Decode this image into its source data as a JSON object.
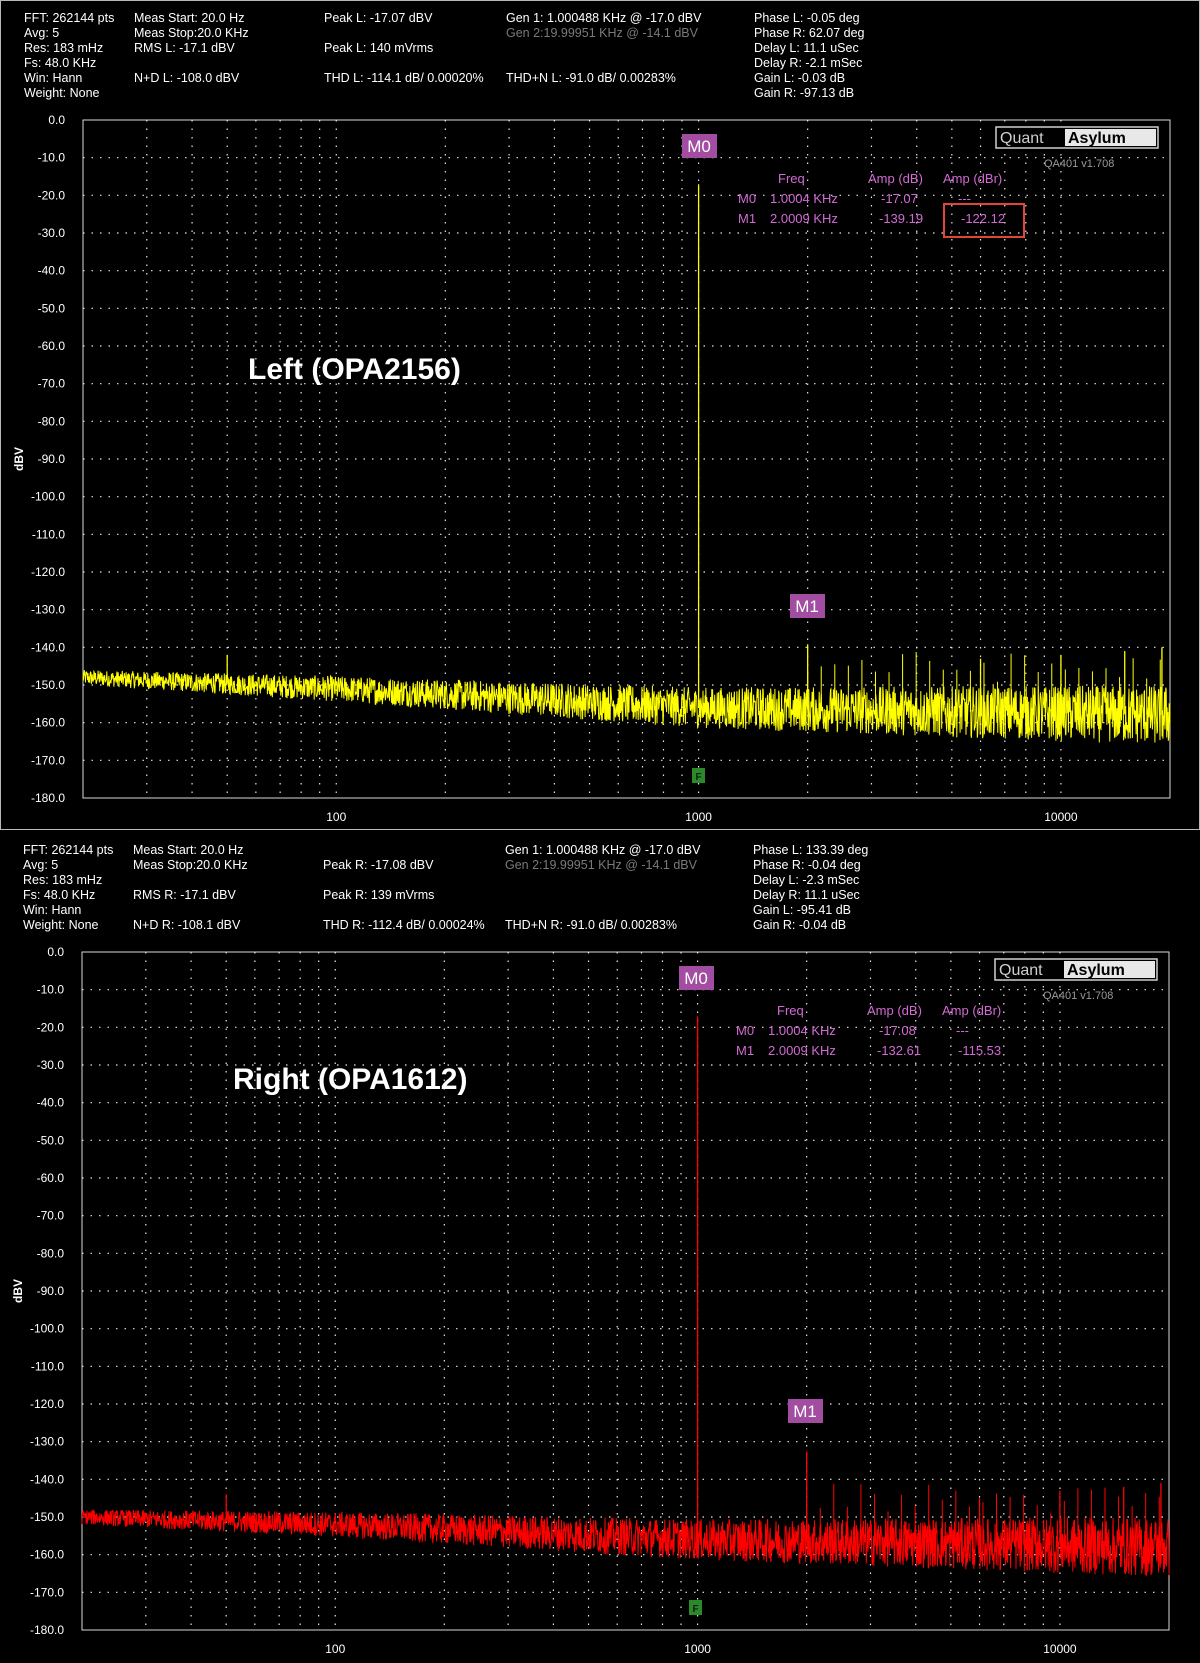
{
  "colors": {
    "left_trace": "#ffff00",
    "right_trace": "#ff0000",
    "marker_bg": "#a24da2",
    "marker_table": "#d36ad3",
    "grid": "#ffffff",
    "f_marker": "#2a8a2a",
    "highlight_box": "#e0443a"
  },
  "left": {
    "stats": {
      "fft": "FFT: 262144 pts",
      "avg": "Avg: 5",
      "res": "Res: 183 mHz",
      "fs": "Fs: 48.0 KHz",
      "win": "Win: Hann",
      "weight": "Weight: None",
      "meas_start": "Meas Start: 20.0 Hz",
      "meas_stop": "Meas Stop:20.0 KHz",
      "rms": "RMS L: -17.1 dBV",
      "nd": "N+D L: -108.0 dBV",
      "peak": "Peak L: -17.07 dBV",
      "peak2": "Peak L: 140 mVrms",
      "thd": "THD L: -114.1 dB/ 0.00020%",
      "gen1": "Gen 1: 1.000488 KHz @ -17.0  dBV",
      "gen2": "Gen 2:19.99951 KHz @ -14.1  dBV",
      "thdn": "THD+N L: -91.0 dB/ 0.00283%",
      "phase_l": "Phase L: -0.05 deg",
      "phase_r": "Phase R: 62.07 deg",
      "delay_l": "Delay L: 11.1 uSec",
      "delay_r": "Delay R: -2.1 mSec",
      "gain_l": "Gain L: -0.03 dB",
      "gain_r": "Gain R: -97.13 dB"
    },
    "label": "Left (OPA2156)",
    "markers_table": {
      "h_freq": "Freq",
      "h_amp": "Amp (dB)",
      "h_ampr": "Amp (dBr)",
      "m0": {
        "name": "M0",
        "freq": "1.0004 KHz",
        "amp": "-17.07",
        "ampr": "---"
      },
      "m1": {
        "name": "M1",
        "freq": "2.0009 KHz",
        "amp": "-139.19",
        "ampr": "-122.12"
      }
    }
  },
  "right": {
    "stats": {
      "fft": "FFT: 262144 pts",
      "avg": "Avg: 5",
      "res": "Res: 183 mHz",
      "fs": "Fs: 48.0 KHz",
      "win": "Win: Hann",
      "weight": "Weight: None",
      "meas_start": "Meas Start: 20.0 Hz",
      "meas_stop": "Meas Stop:20.0 KHz",
      "rms": "RMS R: -17.1 dBV",
      "nd": "N+D R: -108.1 dBV",
      "peak": "Peak R: -17.08 dBV",
      "peak2": "Peak R: 139 mVrms",
      "thd": "THD R: -112.4 dB/ 0.00024%",
      "gen1": "Gen 1: 1.000488 KHz @ -17.0  dBV",
      "gen2": "Gen 2:19.99951 KHz @ -14.1  dBV",
      "thdn": "THD+N R: -91.0 dB/ 0.00283%",
      "phase_l": "Phase L: 133.39 deg",
      "phase_r": "Phase R: -0.04 deg",
      "delay_l": "Delay L: -2.3 mSec",
      "delay_r": "Delay R: 11.1 uSec",
      "gain_l": "Gain L: -95.41 dB",
      "gain_r": "Gain R: -0.04 dB"
    },
    "label": "Right (OPA1612)",
    "markers_table": {
      "h_freq": "Freq",
      "h_amp": "Amp (dB)",
      "h_ampr": "Amp (dBr)",
      "m0": {
        "name": "M0",
        "freq": "1.0004 KHz",
        "amp": "-17.08",
        "ampr": "---"
      },
      "m1": {
        "name": "M1",
        "freq": "2.0009 KHz",
        "amp": "-132.61",
        "ampr": "-115.53"
      }
    }
  },
  "logo": {
    "part1": "Quant",
    "part2": "Asylum",
    "version": "QA401 v1.708"
  },
  "f_label": "F",
  "chart_data": [
    {
      "type": "line",
      "title": "Left (OPA2156)",
      "xlabel": "",
      "ylabel": "dBV",
      "xscale": "log",
      "xlim": [
        20,
        20000
      ],
      "ylim": [
        -180,
        0
      ],
      "yticks": [
        "0.0",
        "-10.0",
        "-20.0",
        "-30.0",
        "-40.0",
        "-50.0",
        "-60.0",
        "-70.0",
        "-80.0",
        "-90.0",
        "-100.0",
        "-110.0",
        "-120.0",
        "-130.0",
        "-140.0",
        "-150.0",
        "-160.0",
        "-170.0",
        "-180.0"
      ],
      "xticks": [
        "100",
        "1000",
        "10000"
      ],
      "grid": true,
      "series": [
        {
          "name": "Left",
          "noise_floor": [
            [
              20,
              -148
            ],
            [
              100,
              -151
            ],
            [
              1000,
              -156
            ],
            [
              20000,
              -158
            ]
          ],
          "peaks": [
            [
              1000,
              -17.07
            ],
            [
              2000,
              -139.19
            ],
            [
              50,
              -142
            ],
            [
              6000,
              -143
            ],
            [
              10000,
              -142
            ],
            [
              15000,
              -141
            ],
            [
              19000,
              -140
            ]
          ]
        }
      ],
      "markers": [
        {
          "name": "M0",
          "x": 1000.4,
          "y": -17.07
        },
        {
          "name": "M1",
          "x": 2000.9,
          "y": -139.19
        }
      ]
    },
    {
      "type": "line",
      "title": "Right (OPA1612)",
      "xlabel": "",
      "ylabel": "dBV",
      "xscale": "log",
      "xlim": [
        20,
        20000
      ],
      "ylim": [
        -180,
        0
      ],
      "yticks": [
        "0.0",
        "-10.0",
        "-20.0",
        "-30.0",
        "-40.0",
        "-50.0",
        "-60.0",
        "-70.0",
        "-80.0",
        "-90.0",
        "-100.0",
        "-110.0",
        "-120.0",
        "-130.0",
        "-140.0",
        "-150.0",
        "-160.0",
        "-170.0",
        "-180.0"
      ],
      "xticks": [
        "100",
        "1000",
        "10000"
      ],
      "grid": true,
      "series": [
        {
          "name": "Right",
          "noise_floor": [
            [
              20,
              -150
            ],
            [
              100,
              -152
            ],
            [
              1000,
              -156
            ],
            [
              20000,
              -158
            ]
          ],
          "peaks": [
            [
              1000,
              -17.08
            ],
            [
              2000,
              -132.61
            ],
            [
              50,
              -144
            ],
            [
              6000,
              -145
            ],
            [
              10000,
              -143
            ],
            [
              15000,
              -142
            ],
            [
              19000,
              -141
            ]
          ]
        }
      ],
      "markers": [
        {
          "name": "M0",
          "x": 1000.4,
          "y": -17.08
        },
        {
          "name": "M1",
          "x": 2000.9,
          "y": -132.61
        }
      ]
    }
  ]
}
